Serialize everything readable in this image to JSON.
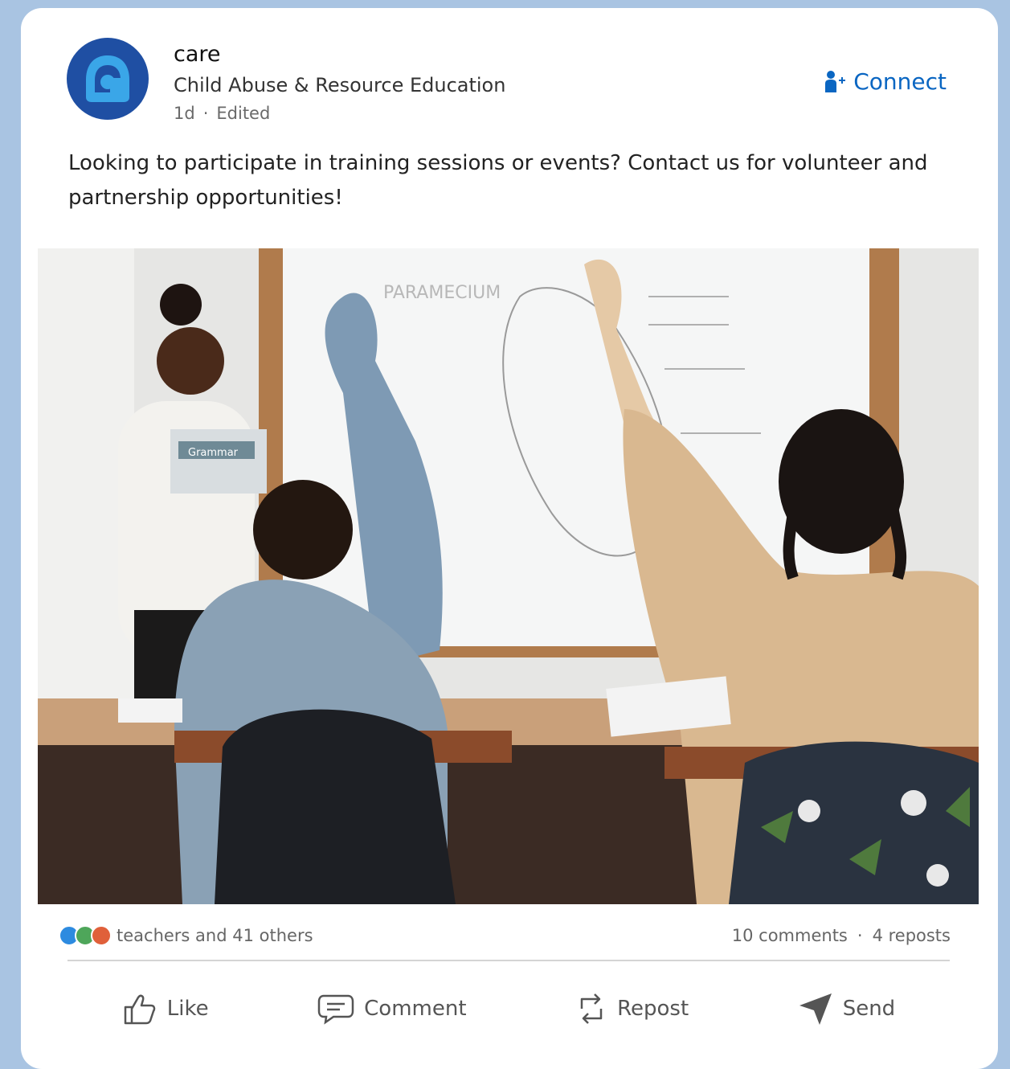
{
  "post": {
    "author": "care",
    "org": "Child Abuse & Resource Education",
    "time": "1d",
    "edited": "Edited",
    "connect_label": "Connect",
    "text": "Looking to participate in training sessions or events? Contact us for volunteer and partnership opportunities!",
    "photo_book_label": "Grammar",
    "whiteboard_title": "PARAMECIUM"
  },
  "social": {
    "reactions_text": "teachers and 41 others",
    "comments": "10 comments",
    "separator": "·",
    "reposts": "4 reposts"
  },
  "actions": {
    "like": "Like",
    "comment": "Comment",
    "repost": "Repost",
    "send": "Send"
  },
  "colors": {
    "accent": "#0a66c2",
    "avatar_bg": "#1f4fa3",
    "page_bg": "#a9c4e2"
  }
}
